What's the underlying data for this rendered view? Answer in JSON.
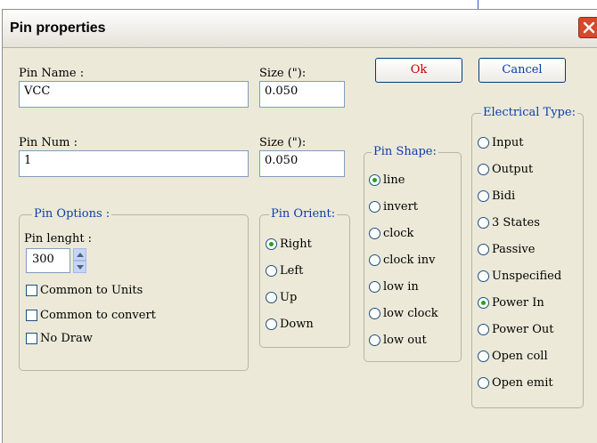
{
  "dialog": {
    "title": "Pin properties"
  },
  "buttons": {
    "ok": "Ok",
    "cancel": "Cancel"
  },
  "fields": {
    "pin_name_label": "Pin Name :",
    "pin_name_value": "VCC",
    "size1_label": "Size (\"):",
    "size1_value": "0.050",
    "pin_num_label": "Pin Num :",
    "pin_num_value": "1",
    "size2_label": "Size (\"):",
    "size2_value": "0.050"
  },
  "pin_options": {
    "legend": "Pin Options :",
    "length_label": "Pin lenght :",
    "length_value": "300",
    "checkboxes": [
      "Common to Units",
      "Common to convert",
      "No Draw"
    ]
  },
  "pin_orient": {
    "legend": "Pin Orient:",
    "options": [
      "Right",
      "Left",
      "Up",
      "Down"
    ],
    "selected": "Right"
  },
  "pin_shape": {
    "legend": "Pin Shape:",
    "options": [
      "line",
      "invert",
      "clock",
      "clock inv",
      "low in",
      "low clock",
      "low out"
    ],
    "selected": "line"
  },
  "electrical_type": {
    "legend": "Electrical Type:",
    "options": [
      "Input",
      "Output",
      "Bidi",
      "3 States",
      "Passive",
      "Unspecified",
      "Power In",
      "Power Out",
      "Open coll",
      "Open emit"
    ],
    "selected": "Power In"
  },
  "icons": {
    "close": "close-icon",
    "spin_up": "chevron-up-icon",
    "spin_down": "chevron-down-icon"
  },
  "colors": {
    "legend_text": "#0b3ea8",
    "ok_text": "#c00000",
    "cancel_text": "#0b3ea8",
    "close_button": "#d8482a"
  }
}
